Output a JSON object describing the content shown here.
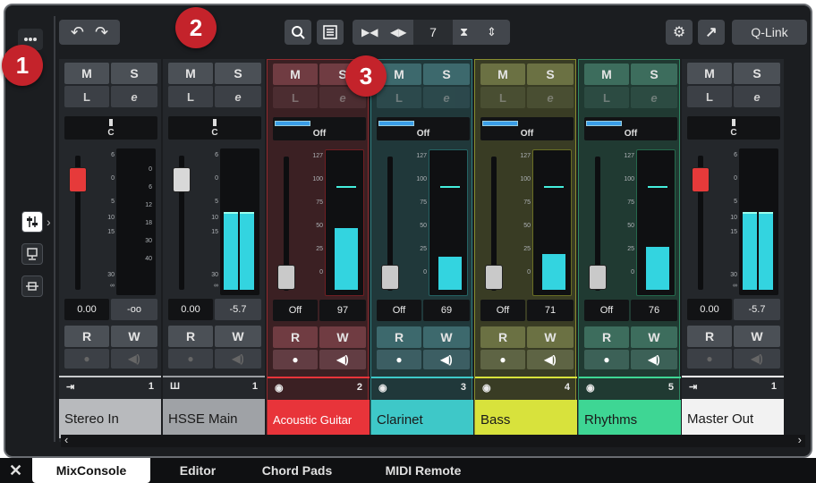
{
  "toolbar": {
    "menu_icon": "more-dots-icon",
    "undo_icon": "undo-icon",
    "redo_icon": "redo-icon",
    "search_icon": "search-icon",
    "list_icon": "list-icon",
    "shrink_icon": "shrink-horizontal-icon",
    "expand_icon": "expand-horizontal-icon",
    "channel_count": "7",
    "fit_icon": "fit-vertical-icon",
    "updown_icon": "up-down-icon",
    "settings_icon": "gear-icon",
    "external_icon": "arrow-up-right-icon",
    "qlink_label": "Q-Link"
  },
  "badges": [
    "1",
    "2",
    "3"
  ],
  "side_buttons": [
    "faders-icon",
    "monitor-icon",
    "routing-icon"
  ],
  "strip_labels": {
    "mute": "M",
    "solo": "S",
    "listen": "L",
    "edit": "e",
    "read": "R",
    "write": "W"
  },
  "scale_db": [
    "6",
    "0",
    "5",
    "10",
    "15",
    "30",
    "∞"
  ],
  "scale_db_right": [
    "0",
    "6",
    "12",
    "18",
    "30",
    "40"
  ],
  "scale_midi": [
    "127",
    "100",
    "75",
    "50",
    "25",
    "0"
  ],
  "channels": [
    {
      "name": "Stereo In",
      "number": "1",
      "pan": "C",
      "fader_value": "0.00",
      "meter_value": "-oo",
      "kind": "audio",
      "color": "#c8cacc",
      "name_bg": "#b8babd",
      "name_color": "#1a1a1a",
      "fader_level": 0.82,
      "meter_level": 0
    },
    {
      "name": "HSSE Main",
      "number": "1",
      "pan": "C",
      "fader_value": "0.00",
      "meter_value": "-5.7",
      "kind": "audio",
      "color": "#9a9da1",
      "name_bg": "#9fa2a6",
      "name_color": "#1a1a1a",
      "fader_level": 0.82,
      "meter_level": 0.58
    },
    {
      "name": "Acoustic Guitar",
      "number": "2",
      "pan": "Off",
      "fader_value": "Off",
      "meter_value": "97",
      "kind": "midi",
      "color": "#e8343a",
      "name_bg": "#e8343a",
      "name_color": "#ffffff",
      "fader_level": 0.1,
      "meter_level": 0.46
    },
    {
      "name": "Clarinet",
      "number": "3",
      "pan": "Off",
      "fader_value": "Off",
      "meter_value": "69",
      "kind": "midi",
      "color": "#3ec8c8",
      "name_bg": "#3ec8c8",
      "name_color": "#1a1a1a",
      "fader_level": 0.1,
      "meter_level": 0.25
    },
    {
      "name": "Bass",
      "number": "4",
      "pan": "Off",
      "fader_value": "Off",
      "meter_value": "71",
      "kind": "midi",
      "color": "#d8e23c",
      "name_bg": "#d8e23c",
      "name_color": "#1a1a1a",
      "fader_level": 0.1,
      "meter_level": 0.27
    },
    {
      "name": "Rhythms",
      "number": "5",
      "pan": "Off",
      "fader_value": "Off",
      "meter_value": "76",
      "kind": "midi",
      "color": "#3ed694",
      "name_bg": "#3ed694",
      "name_color": "#1a1a1a",
      "fader_level": 0.1,
      "meter_level": 0.32
    },
    {
      "name": "Master Out",
      "number": "1",
      "pan": "C",
      "fader_value": "0.00",
      "meter_value": "-5.7",
      "kind": "audio",
      "color": "#ffffff",
      "name_bg": "#f2f2f2",
      "name_color": "#1a1a1a",
      "fader_level": 0.82,
      "meter_level": 0.58
    }
  ],
  "scroll": {
    "left_icon": "chevron-left-icon",
    "right_icon": "chevron-right-icon"
  },
  "tabs": {
    "close_icon": "close-icon",
    "items": [
      "MixConsole",
      "Editor",
      "Chord Pads",
      "MIDI Remote"
    ],
    "active": "MixConsole"
  },
  "colors": {
    "accent_blue": "#3a9ee8",
    "meter_cyan": "#33d4e0",
    "fader_red": "#e63a3a"
  }
}
